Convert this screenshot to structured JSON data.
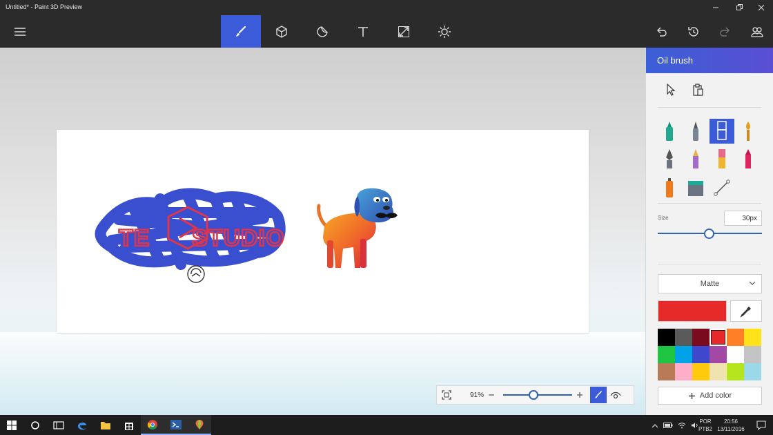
{
  "window": {
    "title": "Untitled* - Paint 3D Preview",
    "minimize_icon": "minimize-icon",
    "maximize_icon": "maximize-icon",
    "close_icon": "close-icon"
  },
  "toolbar": {
    "tools": [
      {
        "id": "brushes",
        "icon": "brush-icon",
        "active": true
      },
      {
        "id": "3d-objects",
        "icon": "cube-icon",
        "active": false
      },
      {
        "id": "stickers",
        "icon": "sticker-icon",
        "active": false
      },
      {
        "id": "text",
        "icon": "text-icon",
        "active": false
      },
      {
        "id": "canvas",
        "icon": "resize-icon",
        "active": false
      },
      {
        "id": "effects",
        "icon": "sun-icon",
        "active": false
      }
    ],
    "right": [
      "undo-icon",
      "history-icon",
      "redo-icon",
      "community-icon"
    ]
  },
  "canvas": {
    "zoom": "91%"
  },
  "panel": {
    "title": "Oil brush",
    "size_label": "Size",
    "size_value": "30px",
    "size_fraction": 0.49,
    "finish_label": "Matte",
    "current_color": "#e62a2a",
    "palette": [
      "#000000",
      "#5a5a5a",
      "#7a0a1e",
      "#e62a2a",
      "#ff7f27",
      "#ffe21a",
      "#1fc443",
      "#00a2e8",
      "#3f48cc",
      "#a349a4",
      "#ffffff",
      "#c3c3c3",
      "#b97a57",
      "#ffaec9",
      "#ffc90e",
      "#efe4b0",
      "#b5e61d",
      "#99d9ea"
    ],
    "selected_swatch": 3,
    "add_color_label": "Add color"
  },
  "taskbar": {
    "lang1": "POR",
    "lang2": "PTB2",
    "time": "20:56",
    "date": "13/11/2016"
  },
  "colors": {
    "accent": "#3c5bd9",
    "chrome": "#2b2b2b",
    "scribble": "#3a4fcf",
    "logo_text": "#e0344a"
  }
}
